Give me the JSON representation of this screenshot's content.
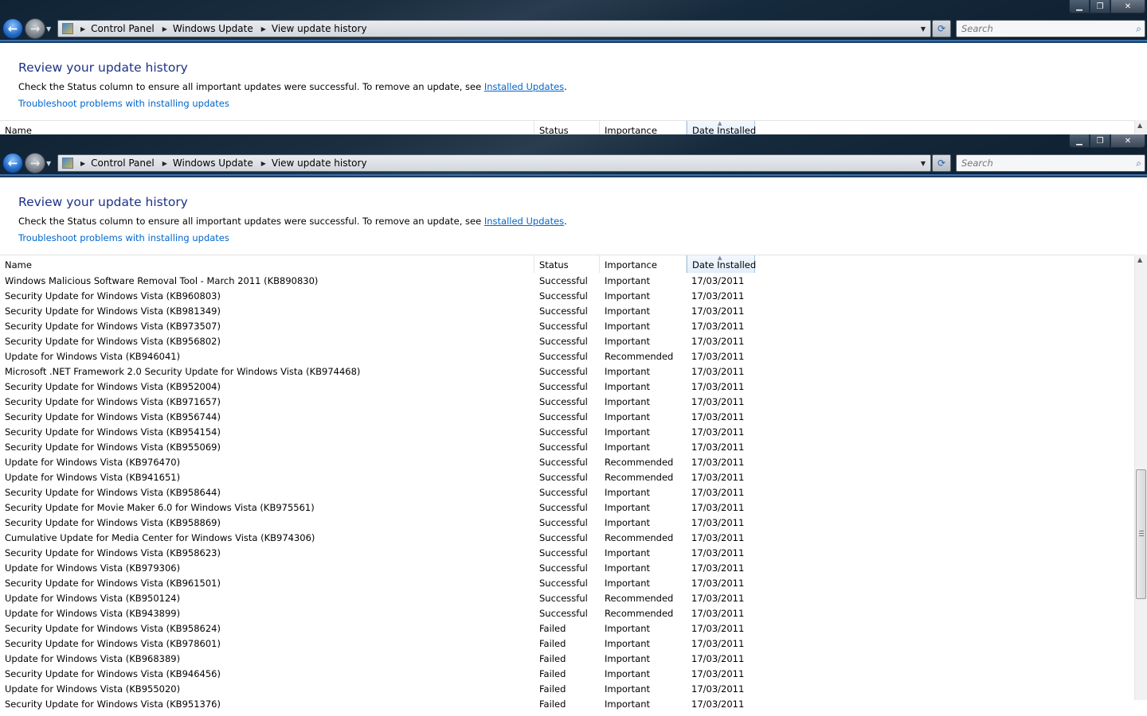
{
  "caption": {
    "min": "▁",
    "max": "❐",
    "close": "✕"
  },
  "nav": {
    "back": "←",
    "forward": "→",
    "drop": "▼"
  },
  "address": {
    "crumbs": [
      "Control Panel",
      "Windows Update",
      "View update history"
    ],
    "sep": "▶",
    "drop": "▼"
  },
  "refresh": "⟳",
  "search": {
    "placeholder": "Search",
    "icon": "⌕"
  },
  "page": {
    "title": "Review your update history",
    "desc_prefix": "Check the Status column to ensure all important updates were successful. To remove an update, see ",
    "desc_link": "Installed Updates",
    "desc_suffix": ".",
    "trouble_link": "Troubleshoot problems with installing updates"
  },
  "columns": {
    "name": "Name",
    "status": "Status",
    "importance": "Importance",
    "date": "Date Installed",
    "sort_arrow": "▲"
  },
  "scroll": {
    "up": "▲"
  },
  "updates": [
    {
      "name": "Windows Malicious Software Removal Tool - March 2011 (KB890830)",
      "status": "Successful",
      "importance": "Important",
      "date": "17/03/2011"
    },
    {
      "name": "Security Update for Windows Vista (KB960803)",
      "status": "Successful",
      "importance": "Important",
      "date": "17/03/2011"
    },
    {
      "name": "Security Update for Windows Vista (KB981349)",
      "status": "Successful",
      "importance": "Important",
      "date": "17/03/2011"
    },
    {
      "name": "Security Update for Windows Vista (KB973507)",
      "status": "Successful",
      "importance": "Important",
      "date": "17/03/2011"
    },
    {
      "name": "Security Update for Windows Vista (KB956802)",
      "status": "Successful",
      "importance": "Important",
      "date": "17/03/2011"
    },
    {
      "name": "Update for Windows Vista (KB946041)",
      "status": "Successful",
      "importance": "Recommended",
      "date": "17/03/2011"
    },
    {
      "name": "Microsoft .NET Framework 2.0 Security Update for Windows Vista (KB974468)",
      "status": "Successful",
      "importance": "Important",
      "date": "17/03/2011"
    },
    {
      "name": "Security Update for Windows Vista (KB952004)",
      "status": "Successful",
      "importance": "Important",
      "date": "17/03/2011"
    },
    {
      "name": "Security Update for Windows Vista (KB971657)",
      "status": "Successful",
      "importance": "Important",
      "date": "17/03/2011"
    },
    {
      "name": "Security Update for Windows Vista (KB956744)",
      "status": "Successful",
      "importance": "Important",
      "date": "17/03/2011"
    },
    {
      "name": "Security Update for Windows Vista (KB954154)",
      "status": "Successful",
      "importance": "Important",
      "date": "17/03/2011"
    },
    {
      "name": "Security Update for Windows Vista (KB955069)",
      "status": "Successful",
      "importance": "Important",
      "date": "17/03/2011"
    },
    {
      "name": "Update for Windows Vista (KB976470)",
      "status": "Successful",
      "importance": "Recommended",
      "date": "17/03/2011"
    },
    {
      "name": "Update for Windows Vista (KB941651)",
      "status": "Successful",
      "importance": "Recommended",
      "date": "17/03/2011"
    },
    {
      "name": "Security Update for Windows Vista (KB958644)",
      "status": "Successful",
      "importance": "Important",
      "date": "17/03/2011"
    },
    {
      "name": "Security Update for Movie Maker 6.0 for Windows Vista (KB975561)",
      "status": "Successful",
      "importance": "Important",
      "date": "17/03/2011"
    },
    {
      "name": "Security Update for Windows Vista (KB958869)",
      "status": "Successful",
      "importance": "Important",
      "date": "17/03/2011"
    },
    {
      "name": "Cumulative Update for Media Center for Windows Vista (KB974306)",
      "status": "Successful",
      "importance": "Recommended",
      "date": "17/03/2011"
    },
    {
      "name": "Security Update for Windows Vista (KB958623)",
      "status": "Successful",
      "importance": "Important",
      "date": "17/03/2011"
    },
    {
      "name": "Update for Windows Vista (KB979306)",
      "status": "Successful",
      "importance": "Important",
      "date": "17/03/2011"
    },
    {
      "name": "Security Update for Windows Vista (KB961501)",
      "status": "Successful",
      "importance": "Important",
      "date": "17/03/2011"
    },
    {
      "name": "Update for Windows Vista (KB950124)",
      "status": "Successful",
      "importance": "Recommended",
      "date": "17/03/2011"
    },
    {
      "name": "Update for Windows Vista (KB943899)",
      "status": "Successful",
      "importance": "Recommended",
      "date": "17/03/2011"
    },
    {
      "name": "Security Update for Windows Vista (KB958624)",
      "status": "Failed",
      "importance": "Important",
      "date": "17/03/2011"
    },
    {
      "name": "Security Update for Windows Vista (KB978601)",
      "status": "Failed",
      "importance": "Important",
      "date": "17/03/2011"
    },
    {
      "name": "Update for Windows Vista (KB968389)",
      "status": "Failed",
      "importance": "Important",
      "date": "17/03/2011"
    },
    {
      "name": "Security Update for Windows Vista (KB946456)",
      "status": "Failed",
      "importance": "Important",
      "date": "17/03/2011"
    },
    {
      "name": "Update for Windows Vista (KB955020)",
      "status": "Failed",
      "importance": "Important",
      "date": "17/03/2011"
    },
    {
      "name": "Security Update for Windows Vista (KB951376)",
      "status": "Failed",
      "importance": "Important",
      "date": "17/03/2011"
    }
  ]
}
